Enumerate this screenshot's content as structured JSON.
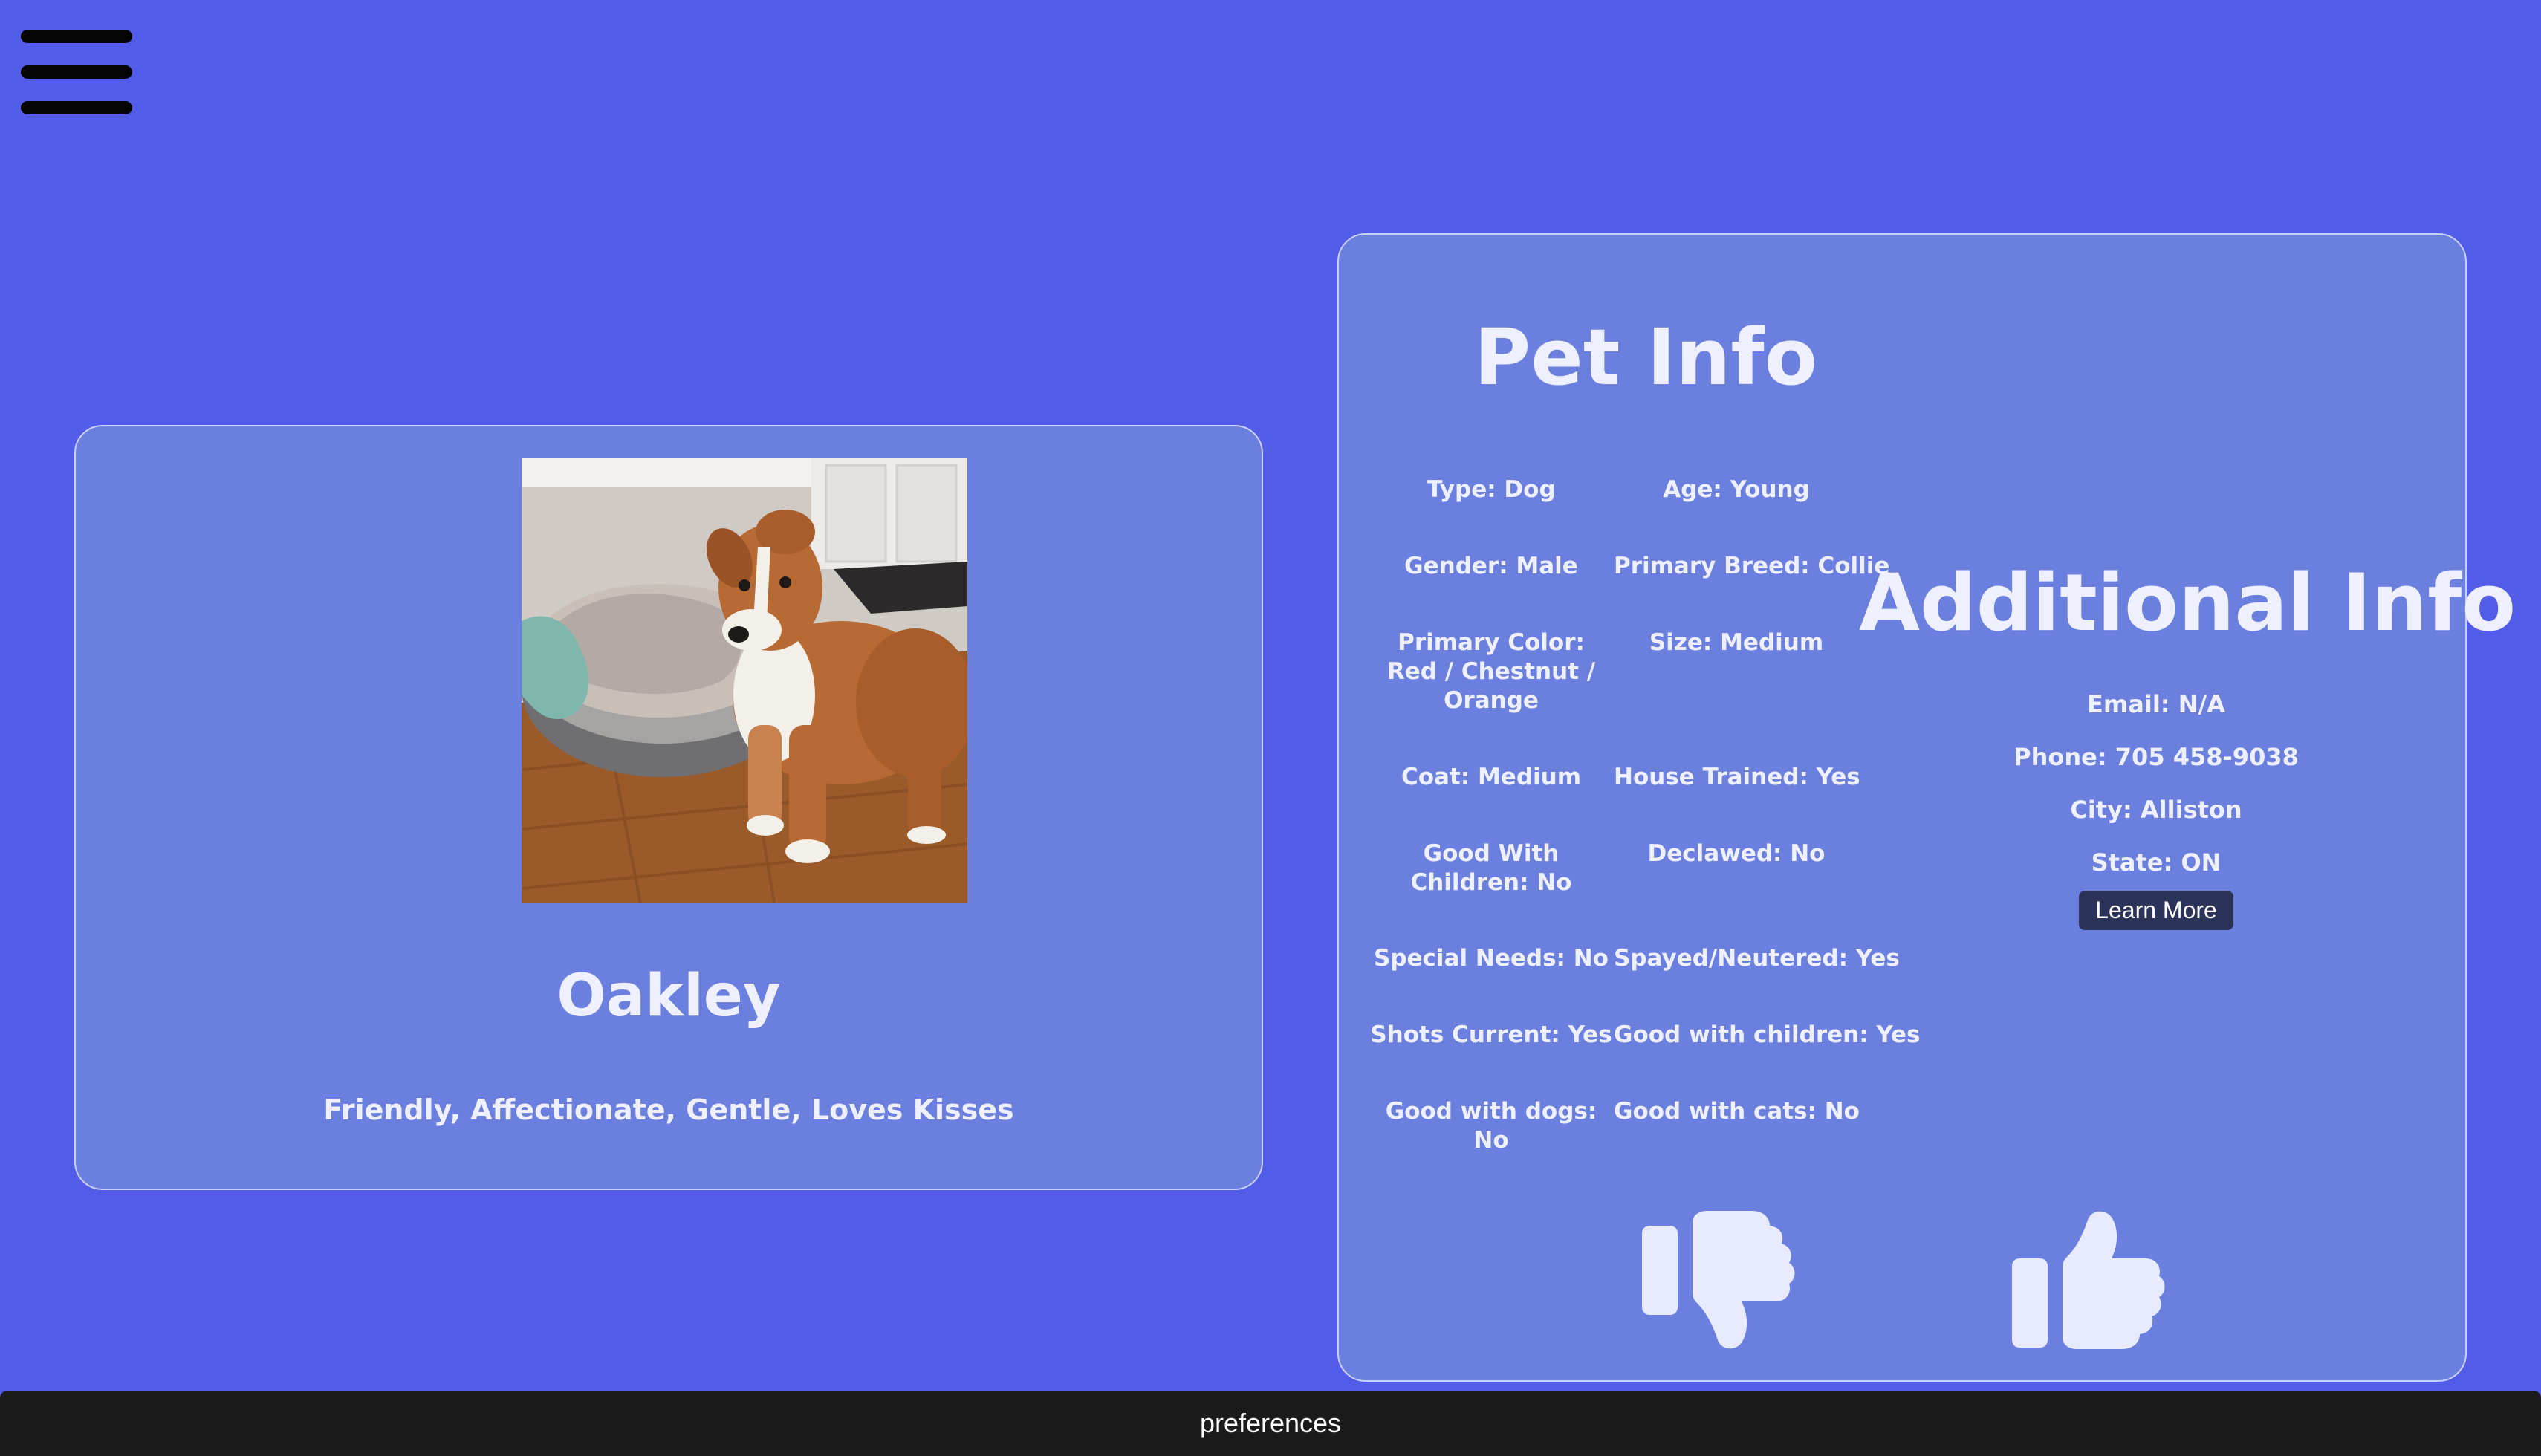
{
  "nav": {
    "menu_icon": "hamburger-menu-icon"
  },
  "pet": {
    "name": "Oakley",
    "tags": "Friendly, Affectionate, Gentle, Loves Kisses",
    "photo_colors": {
      "wall": "#d8d5d0",
      "floor": "#9b5a2a",
      "fur": "#b86a35"
    }
  },
  "pet_info": {
    "title": "Pet Info",
    "attributes": [
      "Type: Dog",
      "Age: Young",
      "Gender: Male",
      "Primary Breed: Collie",
      "Primary Color: Red / Chestnut / Orange",
      "Size: Medium",
      "Coat: Medium",
      "House Trained: Yes",
      "Good With Children: No",
      "Declawed: No",
      "Special Needs: No",
      "Spayed/Neutered: Yes",
      "Shots Current: Yes",
      "Good with children: Yes",
      "Good with dogs: No",
      "Good with cats: No"
    ]
  },
  "additional_info": {
    "title": "Additional Info",
    "email": "Email: N/A",
    "phone": "Phone: 705 458-9038",
    "city": "City: Alliston",
    "state": "State: ON",
    "learn_more_label": "Learn More"
  },
  "actions": {
    "dislike_icon": "thumbs-down-icon",
    "like_icon": "thumbs-up-icon"
  },
  "footer": {
    "label": "preferences"
  },
  "colors": {
    "background": "#535ce8",
    "card": "#6b7fdf",
    "text": "#eef0ff",
    "button": "#2b3358",
    "footer": "#1b1b1b"
  }
}
